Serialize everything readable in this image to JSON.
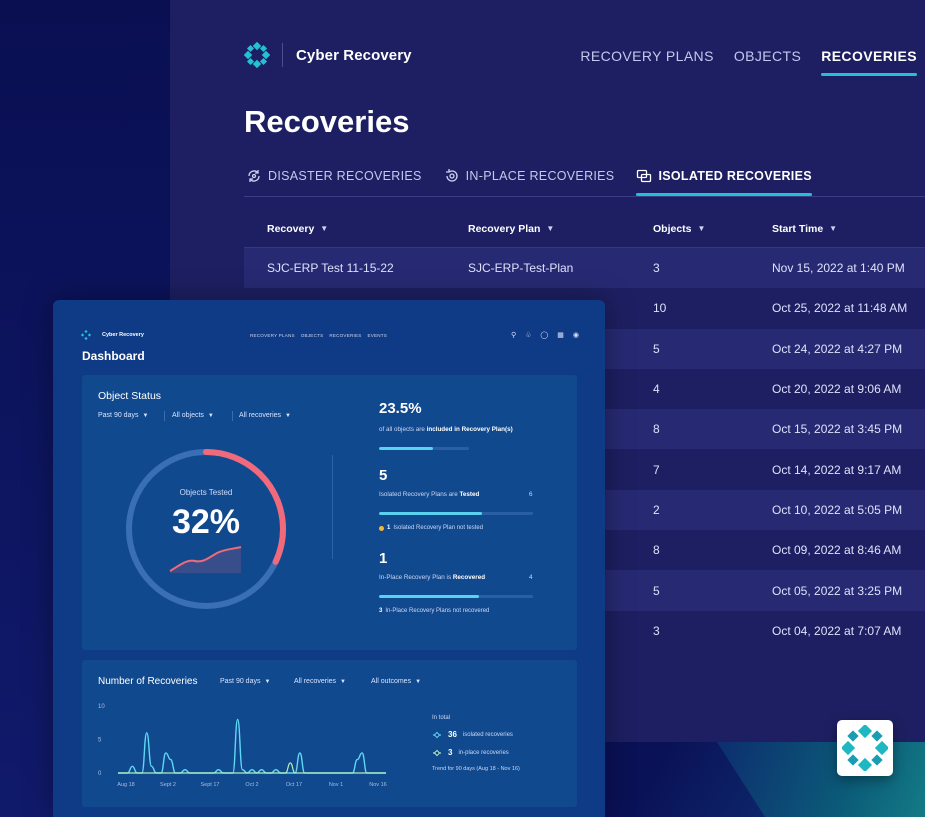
{
  "app": {
    "name": "Cyber Recovery",
    "nav": [
      {
        "label": "RECOVERY PLANS",
        "active": false
      },
      {
        "label": "OBJECTS",
        "active": false
      },
      {
        "label": "RECOVERIES",
        "active": true
      }
    ],
    "page_title": "Recoveries",
    "subtabs": [
      {
        "label": "DISASTER RECOVERIES",
        "icon": "disaster-recovery-icon",
        "active": false
      },
      {
        "label": "IN-PLACE RECOVERIES",
        "icon": "in-place-recovery-icon",
        "active": false
      },
      {
        "label": "ISOLATED RECOVERIES",
        "icon": "isolated-recovery-icon",
        "active": true
      }
    ],
    "table": {
      "columns": [
        "Recovery",
        "Recovery Plan",
        "Objects",
        "Start Time"
      ],
      "rows": [
        [
          "SJC-ERP Test 11-15-22",
          "SJC-ERP-Test-Plan",
          "3",
          "Nov 15, 2022 at 1:40 PM"
        ],
        [
          "",
          "",
          "10",
          "Oct 25, 2022 at 11:48 AM"
        ],
        [
          "",
          "",
          "5",
          "Oct 24, 2022 at 4:27 PM"
        ],
        [
          "",
          "",
          "4",
          "Oct 20, 2022 at 9:06 AM"
        ],
        [
          "",
          "",
          "8",
          "Oct 15, 2022 at 3:45 PM"
        ],
        [
          "",
          "",
          "7",
          "Oct 14, 2022 at 9:17 AM"
        ],
        [
          "",
          "",
          "2",
          "Oct 10, 2022 at 5:05 PM"
        ],
        [
          "",
          "",
          "8",
          "Oct 09, 2022 at 8:46 AM"
        ],
        [
          "",
          "",
          "5",
          "Oct 05, 2022 at 3:25 PM"
        ],
        [
          "",
          "",
          "3",
          "Oct 04, 2022 at 7:07 AM"
        ]
      ]
    }
  },
  "dashboard": {
    "brand": "Cyber Recovery",
    "nav": [
      "RECOVERY PLANS",
      "OBJECTS",
      "RECOVERIES",
      "EVENTS"
    ],
    "title": "Dashboard",
    "object_status": {
      "title": "Object Status",
      "filters": [
        "Past 90 days",
        "All objects",
        "All recoveries"
      ],
      "gauge_label": "Objects Tested",
      "gauge_value": "32%",
      "gauge_fraction": 0.32,
      "stat1_value": "23.5%",
      "stat1_prefix": "of all objects are ",
      "stat1_bold": "included in Recovery Plan(s)",
      "stat1_fraction": 0.6,
      "stat2_value": "5",
      "stat2_prefix": "Isolated Recovery Plans are ",
      "stat2_bold": "Tested",
      "stat2_total": "6",
      "stat2_fraction": 0.67,
      "stat2_note_num": "1",
      "stat2_note_text": " Isolated Recovery Plan not tested",
      "stat3_value": "1",
      "stat3_prefix": "In-Place Recovery Plan is ",
      "stat3_bold": "Recovered",
      "stat3_total": "4",
      "stat3_fraction": 0.65,
      "stat3_note_num": "3",
      "stat3_note_text": " In-Place Recovery Plans not recovered"
    },
    "recoveries": {
      "title": "Number of Recoveries",
      "filters": [
        "Past 90 days",
        "All recoveries",
        "All outcomes"
      ],
      "legend_title": "In total",
      "isolated_count": "36",
      "isolated_label": "isolated recoveries",
      "inplace_count": "3",
      "inplace_label": "in-place recoveries",
      "trend": "Trend for 90 days (Aug 18 - Nov 16)"
    },
    "chart_data": {
      "type": "line",
      "x_ticks": [
        "Aug 18",
        "Sept 2",
        "Sept 17",
        "Oct 2",
        "Oct 17",
        "Nov 1",
        "Nov 16"
      ],
      "y_ticks": [
        "10",
        "5",
        "0"
      ],
      "ylim": [
        0,
        10
      ],
      "series": [
        {
          "values": [
            0,
            0,
            0,
            1,
            0,
            0,
            6,
            1,
            0,
            0,
            3,
            2,
            0,
            0,
            0.5,
            0,
            0,
            0,
            0,
            0,
            0,
            0.5,
            0,
            0,
            0,
            8,
            0.5,
            0,
            0.5,
            0,
            0.5,
            0,
            0,
            0.5,
            0,
            0,
            0,
            0,
            3,
            0,
            0,
            0,
            0,
            0,
            0,
            0,
            0,
            0,
            0,
            0,
            2,
            3,
            0,
            0,
            0,
            0,
            0
          ],
          "color": "#5fd8f5"
        },
        {
          "values": [
            0,
            0,
            0,
            0,
            0,
            0,
            0,
            0,
            0,
            0,
            0,
            0,
            0,
            0,
            0,
            0,
            0,
            0,
            0,
            0,
            0,
            0,
            0,
            0,
            0,
            0,
            0,
            0,
            0,
            0,
            0,
            0,
            0,
            0,
            0,
            0,
            1.5,
            0,
            0,
            0,
            0,
            0,
            0,
            0,
            0,
            0,
            0,
            0,
            0,
            0,
            0,
            0,
            0,
            0,
            0,
            0,
            0
          ],
          "color": "#b4f0b7"
        }
      ]
    }
  },
  "colors": {
    "accent": "#23c1d1",
    "gauge_tested": "#f06a7b",
    "gauge_track": "#3a6fb5",
    "progress_fill": "#5ad1ee"
  }
}
